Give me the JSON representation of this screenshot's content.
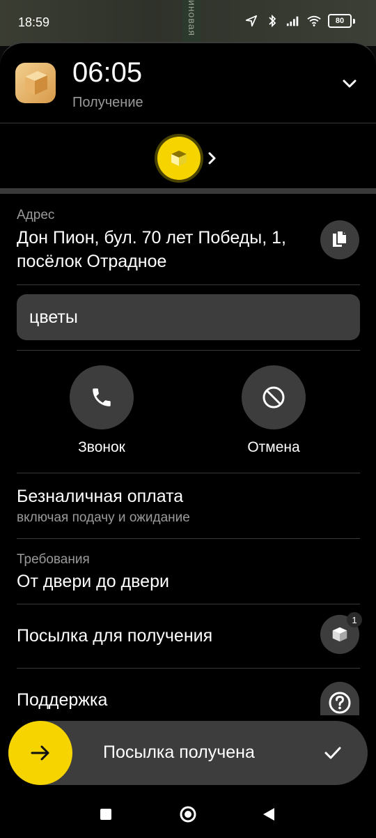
{
  "status_bar": {
    "time": "18:59",
    "battery": "80",
    "map_street_fragment": "иновая"
  },
  "header": {
    "eta": "06:05",
    "status": "Получение"
  },
  "address": {
    "label": "Адрес",
    "value": "Дон Пион, бул. 70 лет Победы, 1, посёлок Отрадное"
  },
  "comment": "цветы",
  "actions": {
    "call_label": "Звонок",
    "cancel_label": "Отмена"
  },
  "payment": {
    "title": "Безналичная оплата",
    "subtitle": "включая подачу и ожидание"
  },
  "requirements": {
    "label": "Требования",
    "value": "От двери до двери"
  },
  "parcel": {
    "title": "Посылка для получения",
    "count": "1"
  },
  "support": {
    "title": "Поддержка"
  },
  "slider": {
    "label": "Посылка получена"
  },
  "colors": {
    "accent": "#f5d400",
    "surface": "#3d3d3d",
    "background": "#000000",
    "muted_text": "#9a9a9a"
  }
}
